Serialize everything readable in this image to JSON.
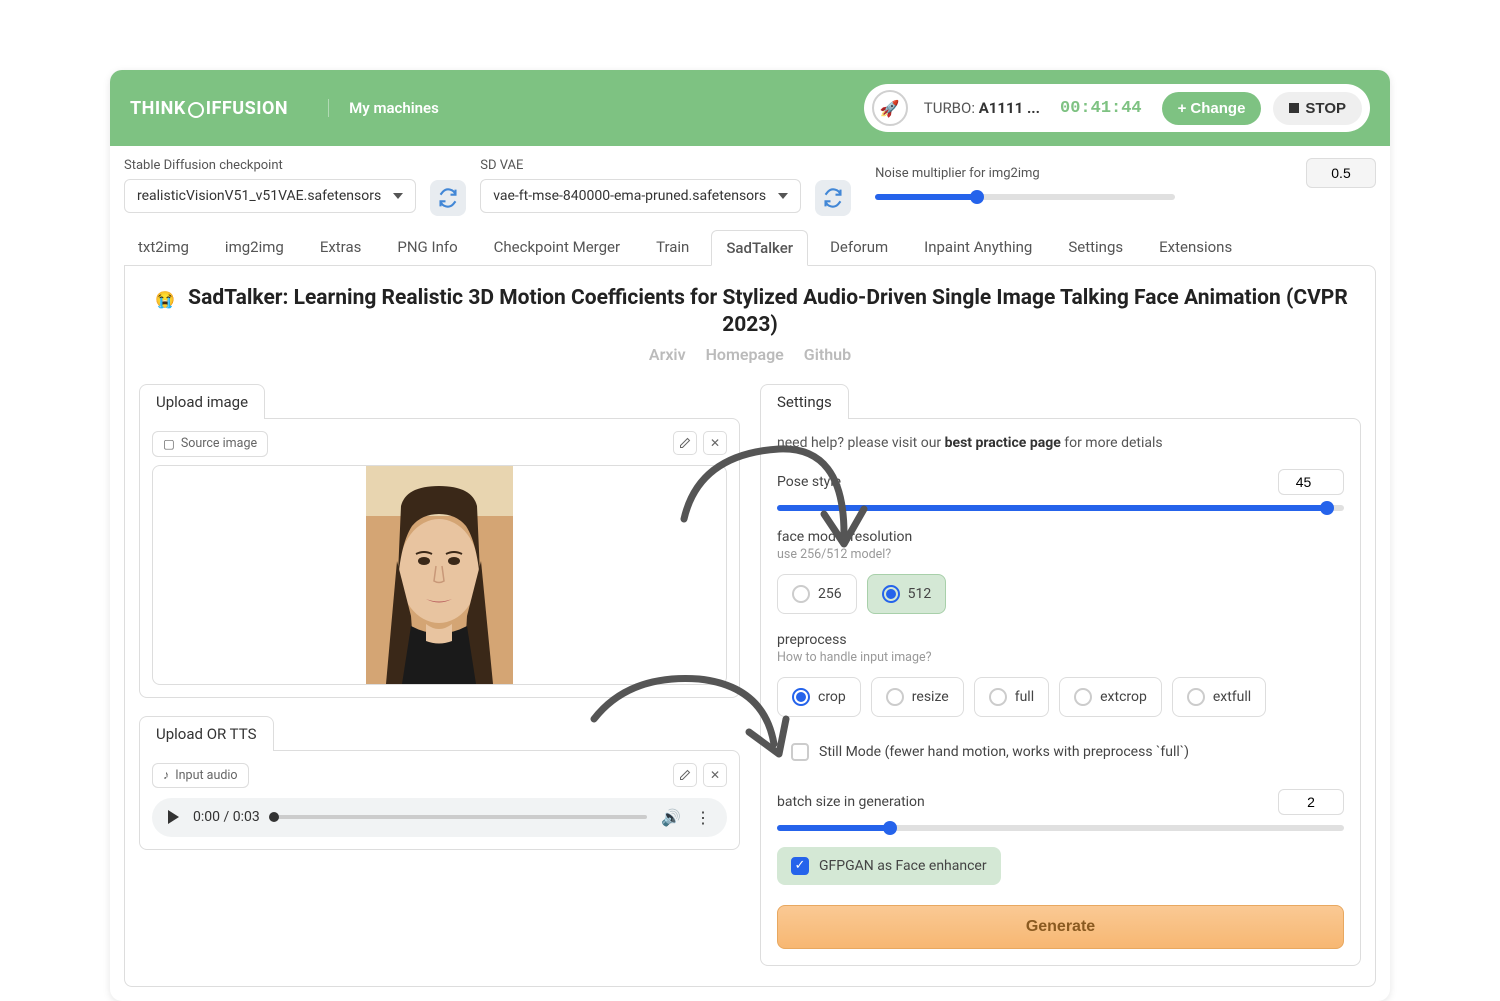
{
  "header": {
    "logo_part1": "THINK",
    "logo_part2": "IFFUSION",
    "my_machines": "My machines",
    "turbo_label": "TURBO: ",
    "turbo_model": "A1111 ...",
    "timer": "00:41:44",
    "change_btn": "Change",
    "stop_btn": "STOP"
  },
  "toolbar": {
    "checkpoint_label": "Stable Diffusion checkpoint",
    "checkpoint_value": "realisticVisionV51_v51VAE.safetensors",
    "vae_label": "SD VAE",
    "vae_value": "vae-ft-mse-840000-ema-pruned.safetensors",
    "noise_label": "Noise multiplier for img2img",
    "noise_value": "0.5"
  },
  "tabs": [
    "txt2img",
    "img2img",
    "Extras",
    "PNG Info",
    "Checkpoint Merger",
    "Train",
    "SadTalker",
    "Deforum",
    "Inpaint Anything",
    "Settings",
    "Extensions"
  ],
  "tabs_active_index": 6,
  "main": {
    "title": "SadTalker: Learning Realistic 3D Motion Coefficients for Stylized Audio-Driven Single Image Talking Face Animation (CVPR 2023)",
    "emoji": "😭",
    "links": [
      "Arxiv",
      "Homepage",
      "Github"
    ]
  },
  "left": {
    "upload_image_tab": "Upload image",
    "source_image_chip": "Source image",
    "upload_tts_tab": "Upload OR TTS",
    "input_audio_chip": "Input audio",
    "audio_current": "0:00",
    "audio_total": "0:03"
  },
  "settings": {
    "tab_label": "Settings",
    "help_prefix": "need help? please visit our ",
    "help_link": "best practice page",
    "help_suffix": " for more detials",
    "pose_label": "Pose style",
    "pose_value": "45",
    "pose_max": 46,
    "face_res_label": "face model resolution",
    "face_res_sublabel": "use 256/512 model?",
    "face_res_options": [
      "256",
      "512"
    ],
    "face_res_selected": 1,
    "preprocess_label": "preprocess",
    "preprocess_sublabel": "How to handle input image?",
    "preprocess_options": [
      "crop",
      "resize",
      "full",
      "extcrop",
      "extfull"
    ],
    "preprocess_selected": 0,
    "still_mode_label": "Still Mode (fewer hand motion, works with preprocess `full`)",
    "still_mode_checked": false,
    "batch_label": "batch size in generation",
    "batch_value": "2",
    "batch_max": 10,
    "gfpgan_label": "GFPGAN as Face enhancer",
    "gfpgan_checked": true,
    "generate_btn": "Generate"
  }
}
